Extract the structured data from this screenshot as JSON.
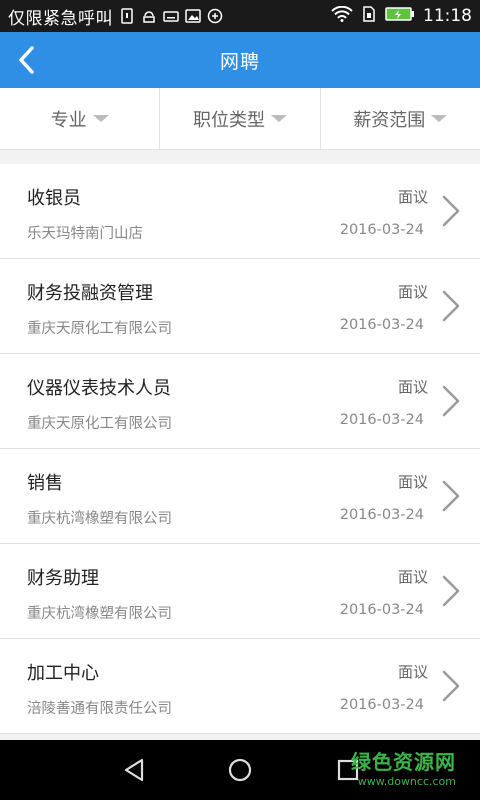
{
  "status_bar": {
    "carrier": "仅限紧急呼叫",
    "time": "11:18"
  },
  "app_bar": {
    "title": "网聘"
  },
  "filters": [
    {
      "label": "专业"
    },
    {
      "label": "职位类型"
    },
    {
      "label": "薪资范围"
    }
  ],
  "jobs": [
    {
      "title": "收银员",
      "company": "乐天玛特南门山店",
      "salary": "面议",
      "date": "2016-03-24"
    },
    {
      "title": "财务投融资管理",
      "company": "重庆天原化工有限公司",
      "salary": "面议",
      "date": "2016-03-24"
    },
    {
      "title": "仪器仪表技术人员",
      "company": "重庆天原化工有限公司",
      "salary": "面议",
      "date": "2016-03-24"
    },
    {
      "title": "销售",
      "company": "重庆杭湾橡塑有限公司",
      "salary": "面议",
      "date": "2016-03-24"
    },
    {
      "title": "财务助理",
      "company": "重庆杭湾橡塑有限公司",
      "salary": "面议",
      "date": "2016-03-24"
    },
    {
      "title": "加工中心",
      "company": "涪陵善通有限责任公司",
      "salary": "面议",
      "date": "2016-03-24"
    }
  ],
  "watermark": {
    "line1": "绿色资源网",
    "line2": "www.downcc.com"
  },
  "colors": {
    "accent": "#2f8fe4",
    "status_bar": "#1a1a1a",
    "battery": "#5ec33a"
  }
}
